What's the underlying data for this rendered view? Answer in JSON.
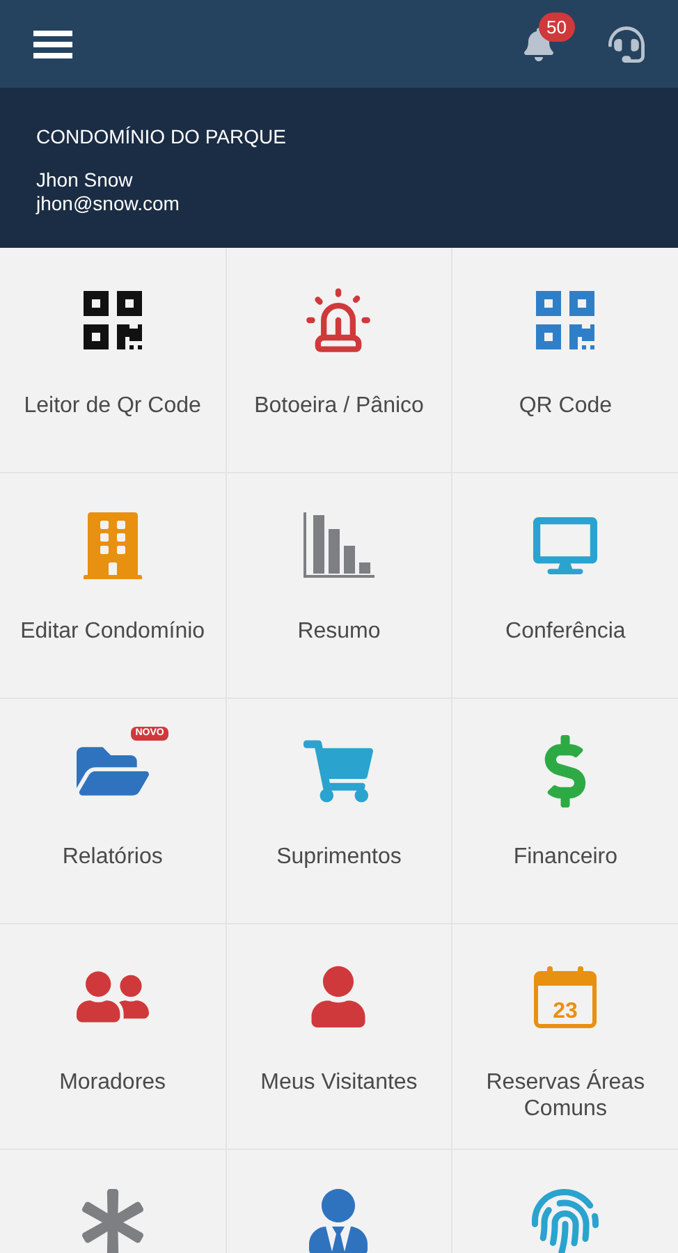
{
  "header": {
    "notification_count": "50"
  },
  "profile": {
    "condominium": "CONDOMÍNIO DO PARQUE",
    "name": "Jhon Snow",
    "email": "jhon@snow.com"
  },
  "tiles": [
    {
      "label": "Leitor de Qr Code",
      "kind": "qr",
      "color": "#111111"
    },
    {
      "label": "Botoeira / Pânico",
      "kind": "siren",
      "color": "#d0393b"
    },
    {
      "label": "QR Code",
      "kind": "qr",
      "color": "#2f7fc8"
    },
    {
      "label": "Editar Condomínio",
      "kind": "building",
      "color": "#e8900f"
    },
    {
      "label": "Resumo",
      "kind": "chart",
      "color": "#7d7f82"
    },
    {
      "label": "Conferência",
      "kind": "monitor",
      "color": "#2aa3cf"
    },
    {
      "label": "Relatórios",
      "kind": "folder",
      "color": "#2f73bf",
      "badge": "NOVO"
    },
    {
      "label": "Suprimentos",
      "kind": "cart",
      "color": "#2aa3cf"
    },
    {
      "label": "Financeiro",
      "kind": "dollar",
      "color": "#2eaa45"
    },
    {
      "label": "Moradores",
      "kind": "users",
      "color": "#d0393b"
    },
    {
      "label": "Meus Visitantes",
      "kind": "user",
      "color": "#d0393b"
    },
    {
      "label": "Reservas Áreas Comuns",
      "kind": "calendar",
      "color": "#e8900f",
      "icon_text": "23"
    },
    {
      "kind": "asterisk",
      "color": "#7d7f82"
    },
    {
      "kind": "businessman",
      "color": "#2f73bf"
    },
    {
      "kind": "fingerprint",
      "color": "#2aa3cf"
    }
  ]
}
